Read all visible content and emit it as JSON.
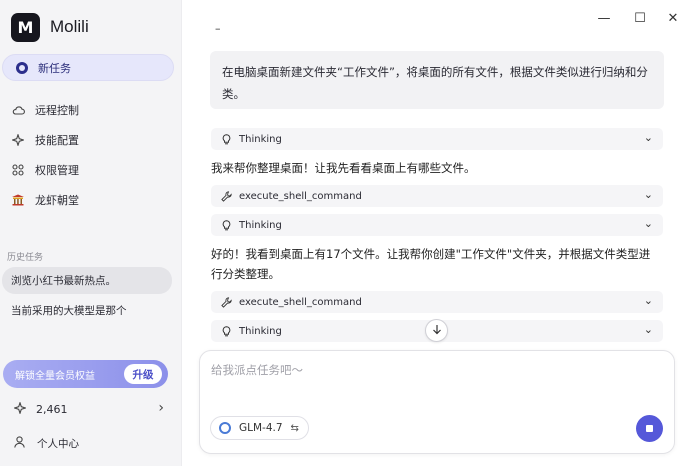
{
  "app": {
    "name": "Molili",
    "logo_letter": "M"
  },
  "sidebar": {
    "new_task": "新任务",
    "nav": [
      {
        "label": "远程控制",
        "icon": "cloud-icon"
      },
      {
        "label": "技能配置",
        "icon": "sparkle-icon"
      },
      {
        "label": "权限管理",
        "icon": "grid-icon"
      },
      {
        "label": "龙虾朝堂",
        "icon": "temple-icon"
      }
    ],
    "history_title": "历史任务",
    "history": [
      "浏览小红书最新热点。",
      "当前采用的大模型是那个"
    ],
    "upgrade_text": "解锁全量会员权益",
    "upgrade_button": "升级",
    "credits": "2,461",
    "profile": "个人中心"
  },
  "window_controls": {
    "minimize": "—",
    "maximize": "☐",
    "close": "✕"
  },
  "conversation": {
    "top_dash": "–",
    "user_message": "在电脑桌面新建文件夹“工作文件”，将桌面的所有文件，根据文件类似进行归纳和分类。",
    "steps": [
      {
        "label": "Thinking",
        "icon": "bulb-icon"
      },
      {
        "label": "execute_shell_command",
        "icon": "wrench-icon"
      },
      {
        "label": "Thinking",
        "icon": "bulb-icon"
      },
      {
        "label": "execute_shell_command",
        "icon": "wrench-icon"
      },
      {
        "label": "Thinking",
        "icon": "bulb-icon"
      }
    ],
    "replies": [
      "我来帮你整理桌面！让我先看看桌面上有哪些文件。",
      "好的！我看到桌面上有17个文件。让我帮你创建\"工作文件\"文件夹，并根据文件类型进",
      "行分类整理。"
    ]
  },
  "composer": {
    "placeholder": "给我派点任务吧～",
    "model": "GLM-4.7"
  },
  "colors": {
    "accent": "#5558d9",
    "upgrade_start": "#a9adf2",
    "upgrade_end": "#8c90ea"
  }
}
